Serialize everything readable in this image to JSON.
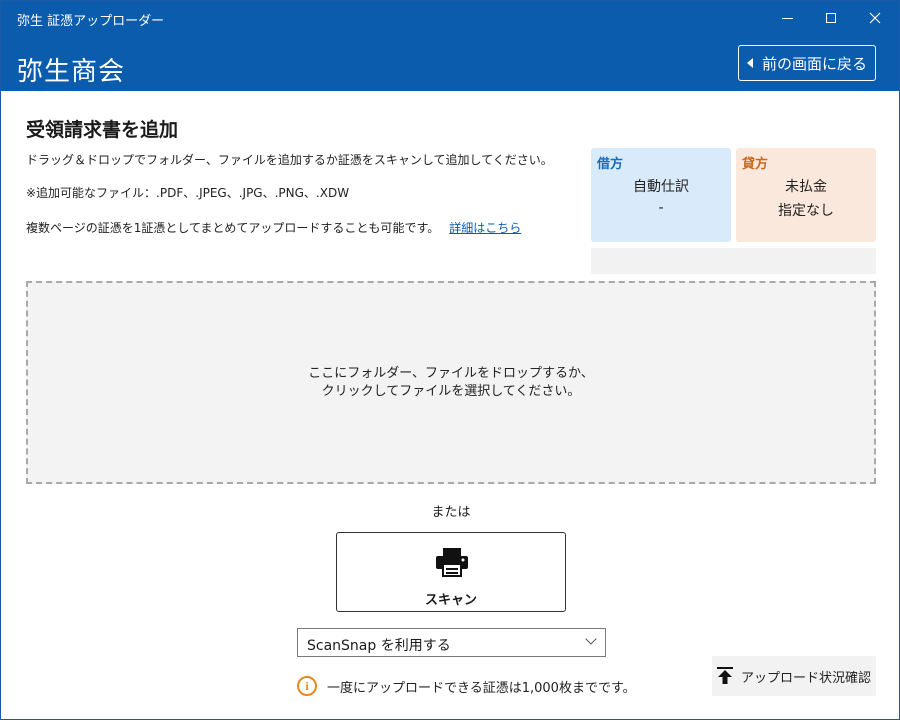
{
  "window": {
    "title": "弥生 証憑アップローダー",
    "minimize": "–",
    "maximize": "□",
    "close": "✕"
  },
  "header": {
    "company": "弥生商会",
    "back_label": "前の画面に戻る"
  },
  "main": {
    "title": "受領請求書を追加",
    "description1": "ドラッグ＆ドロップでフォルダー、ファイルを追加するか証憑をスキャンして追加してください。",
    "description2": "※追加可能なファイル：.PDF、.JPEG、.JPG、.PNG、.XDW",
    "description3": "複数ページの証憑を1証憑としてまとめてアップロードすることも可能です。",
    "detail_link": "詳細はこちら"
  },
  "debit": {
    "label": "借方",
    "value1": "自動仕訳",
    "value2": "-"
  },
  "credit": {
    "label": "貸方",
    "value1": "未払金",
    "value2": "指定なし"
  },
  "dropzone": {
    "line1": "ここにフォルダー、ファイルをドロップするか、",
    "line2": "クリックしてファイルを選択してください。"
  },
  "or_text": "または",
  "scan": {
    "label": "スキャン",
    "icon": "printer-icon"
  },
  "scanner_select": {
    "value": "ScanSnap を利用する"
  },
  "notice": {
    "text": "一度にアップロードできる証憑は1,000枚までです。",
    "icon_glyph": "i"
  },
  "status_button": {
    "label": "アップロード状況確認"
  },
  "colors": {
    "brand": "#0b5cad",
    "debit_bg": "#d9ebfb",
    "credit_bg": "#fbe8dc",
    "notice": "#e8891d"
  }
}
